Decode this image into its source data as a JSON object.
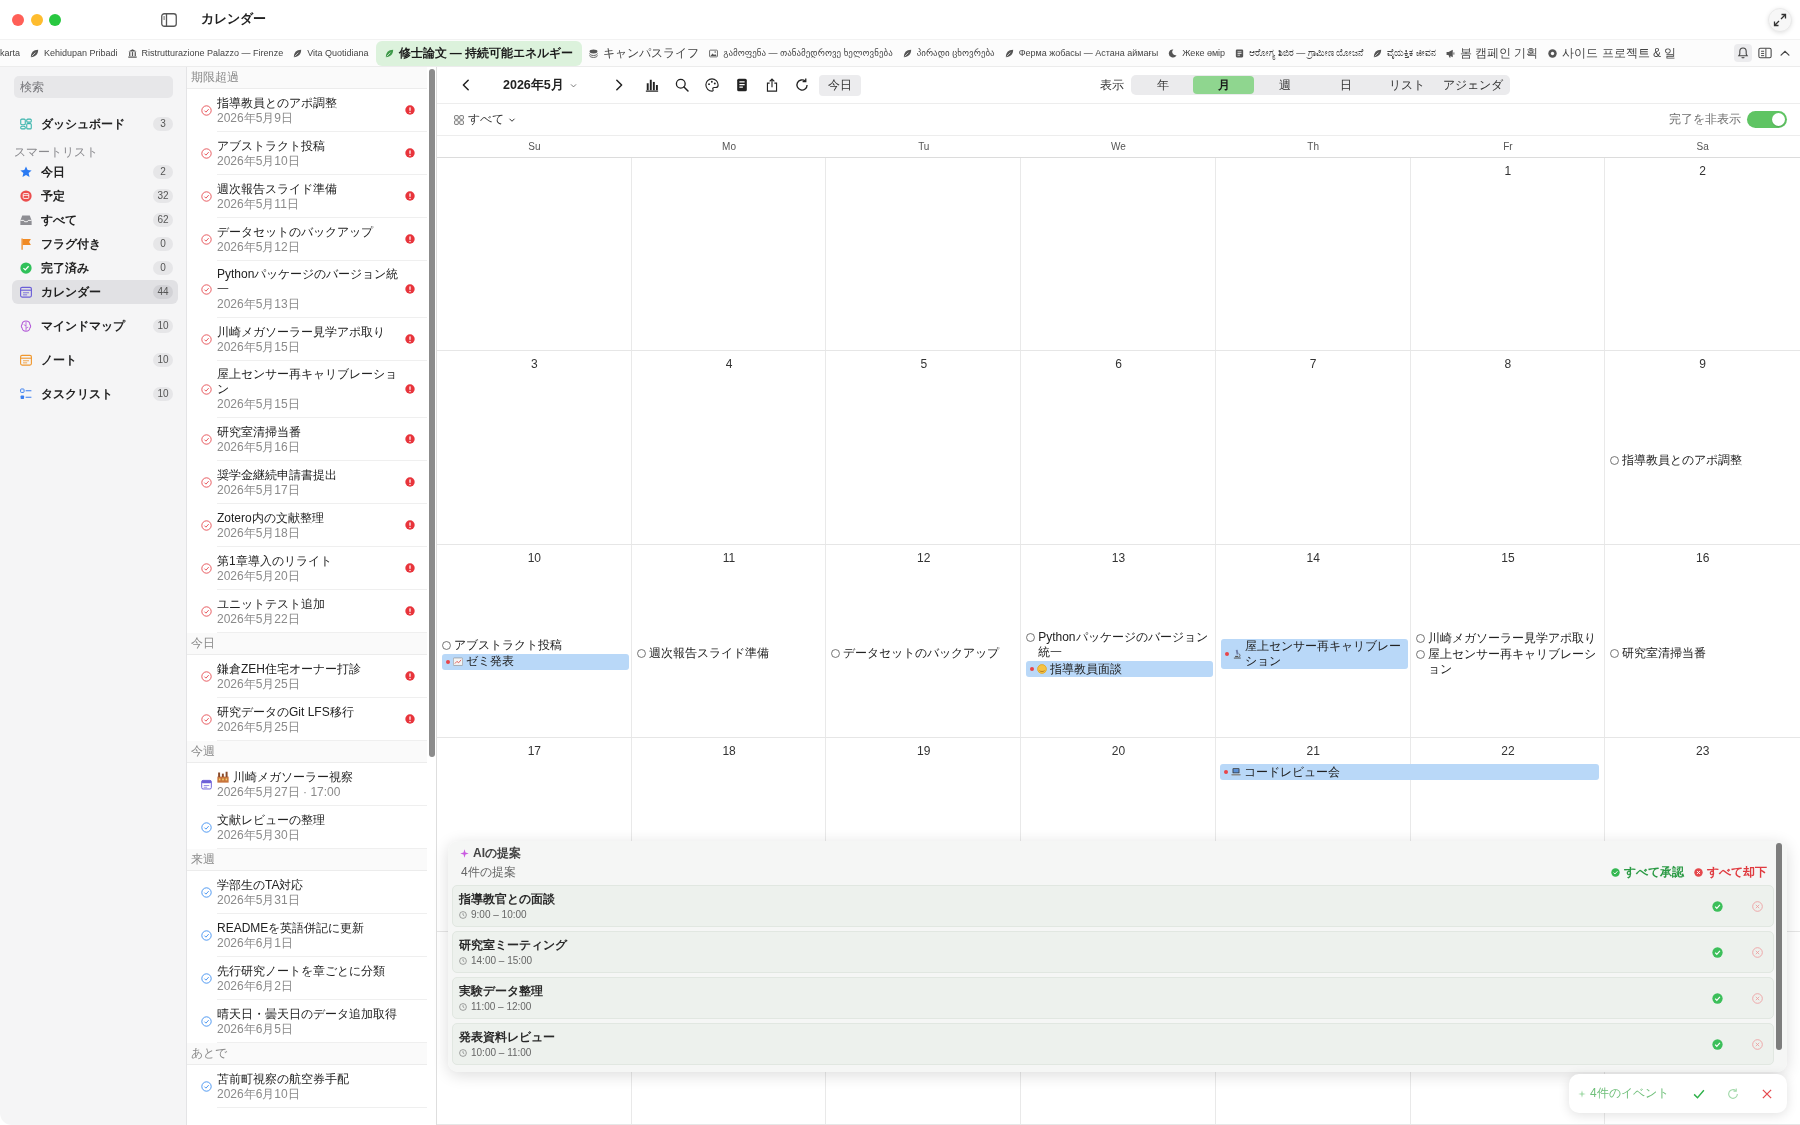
{
  "window": {
    "title": "カレンダー"
  },
  "tabs": [
    {
      "label": "karta",
      "selected": false
    },
    {
      "label": "Kehidupan Pribadi",
      "selected": false
    },
    {
      "label": "Ristrutturazione Palazzo — Firenze",
      "selected": false
    },
    {
      "label": "Vita Quotidiana",
      "selected": false
    },
    {
      "label": "修士論文 — 持続可能エネルギー",
      "selected": true
    },
    {
      "label": "キャンパスライフ",
      "selected": false
    },
    {
      "label": "გამოფენა — თანამედროვე ხელოვნება",
      "selected": false
    },
    {
      "label": "პირადი ცხოვრება",
      "selected": false
    },
    {
      "label": "Ферма жобасы — Астана аймағы",
      "selected": false
    },
    {
      "label": "Жеке өмір",
      "selected": false
    },
    {
      "label": "ಆರೋಗ್ಯ ಶಿಬಿರ — ಗ್ರಾಮೀಣ ಯೋಜನೆ",
      "selected": false
    },
    {
      "label": "ವೈಯಕ್ತಿಕ ಜೀವನ",
      "selected": false
    },
    {
      "label": "봄 캠페인 기획",
      "selected": false
    },
    {
      "label": "사이드 프로젝트 & 일",
      "selected": false
    }
  ],
  "sidebar": {
    "search": {
      "placeholder": "検索"
    },
    "groups": [
      {
        "items": [
          {
            "label": "ダッシュボード",
            "count": "3",
            "selected": false
          }
        ]
      },
      {
        "heading": "スマートリスト",
        "items": [
          {
            "label": "今日",
            "count": "2",
            "selected": false
          },
          {
            "label": "予定",
            "count": "32",
            "selected": false
          },
          {
            "label": "すべて",
            "count": "62",
            "selected": false
          },
          {
            "label": "フラグ付き",
            "count": "0",
            "selected": false
          },
          {
            "label": "完了済み",
            "count": "0",
            "selected": false
          },
          {
            "label": "カレンダー",
            "count": "44",
            "selected": true
          }
        ]
      },
      {
        "items": [
          {
            "label": "マインドマップ",
            "count": "10",
            "selected": false
          }
        ]
      },
      {
        "items": [
          {
            "label": "ノート",
            "count": "10",
            "selected": false
          }
        ]
      },
      {
        "items": [
          {
            "label": "タスクリスト",
            "count": "10",
            "selected": false
          }
        ]
      }
    ]
  },
  "task_list": {
    "sections": [
      {
        "heading": "期限超過",
        "items": [
          {
            "kind": "task",
            "title": "指導教員とのアポ調整",
            "date": "2026年5月9日",
            "overdue": true,
            "high_priority": true
          },
          {
            "kind": "task",
            "title": "アブストラクト投稿",
            "date": "2026年5月10日",
            "overdue": true,
            "high_priority": true
          },
          {
            "kind": "task",
            "title": "週次報告スライド準備",
            "date": "2026年5月11日",
            "overdue": true,
            "high_priority": true
          },
          {
            "kind": "task",
            "title": "データセットのバックアップ",
            "date": "2026年5月12日",
            "overdue": true,
            "high_priority": true
          },
          {
            "kind": "task",
            "title": "Pythonパッケージのバージョン統一",
            "date": "2026年5月13日",
            "overdue": true,
            "high_priority": true
          },
          {
            "kind": "task",
            "title": "川崎メガソーラー見学アポ取り",
            "date": "2026年5月15日",
            "overdue": true,
            "high_priority": true
          },
          {
            "kind": "task",
            "title": "屋上センサー再キャリブレーション",
            "date": "2026年5月15日",
            "overdue": true,
            "high_priority": true
          },
          {
            "kind": "task",
            "title": "研究室清掃当番",
            "date": "2026年5月16日",
            "overdue": true,
            "high_priority": true
          },
          {
            "kind": "task",
            "title": "奨学金継続申請書提出",
            "date": "2026年5月17日",
            "overdue": true,
            "high_priority": true
          },
          {
            "kind": "task",
            "title": "Zotero内の文献整理",
            "date": "2026年5月18日",
            "overdue": true,
            "high_priority": true
          },
          {
            "kind": "task",
            "title": "第1章導入のリライト",
            "date": "2026年5月20日",
            "overdue": true,
            "high_priority": true
          },
          {
            "kind": "task",
            "title": "ユニットテスト追加",
            "date": "2026年5月22日",
            "overdue": true,
            "high_priority": true
          }
        ]
      },
      {
        "heading": "今日",
        "items": [
          {
            "kind": "task",
            "title": "鎌倉ZEH住宅オーナー打診",
            "date": "2026年5月25日",
            "overdue": true,
            "high_priority": true
          },
          {
            "kind": "task",
            "title": "研究データのGit LFS移行",
            "date": "2026年5月25日",
            "overdue": true,
            "high_priority": true
          }
        ]
      },
      {
        "heading": "今週",
        "items": [
          {
            "kind": "event",
            "title": "川崎メガソーラー視察",
            "date": "2026年5月27日 · 17:00",
            "overdue": false,
            "high_priority": false
          },
          {
            "kind": "task",
            "title": "文献レビューの整理",
            "date": "2026年5月30日",
            "overdue": false,
            "high_priority": false
          }
        ]
      },
      {
        "heading": "来週",
        "items": [
          {
            "kind": "task",
            "title": "学部生のTA対応",
            "date": "2026年5月31日",
            "overdue": false,
            "high_priority": false
          },
          {
            "kind": "task",
            "title": "READMEを英語併記に更新",
            "date": "2026年6月1日",
            "overdue": false,
            "high_priority": false
          },
          {
            "kind": "task",
            "title": "先行研究ノートを章ごとに分類",
            "date": "2026年6月2日",
            "overdue": false,
            "high_priority": false
          },
          {
            "kind": "task",
            "title": "晴天日・曇天日のデータ追加取得",
            "date": "2026年6月5日",
            "overdue": false,
            "high_priority": false
          }
        ]
      },
      {
        "heading": "あとで",
        "items": [
          {
            "kind": "task",
            "title": "苫前町視察の航空券手配",
            "date": "2026年6月10日",
            "overdue": false,
            "high_priority": false
          }
        ]
      }
    ]
  },
  "calendar": {
    "toolbar": {
      "month": "2026年5月",
      "today_button": "今日",
      "view_label": "表示",
      "views": [
        {
          "label": "年",
          "selected": false
        },
        {
          "label": "月",
          "selected": true
        },
        {
          "label": "週",
          "selected": false
        },
        {
          "label": "日",
          "selected": false
        },
        {
          "label": "リスト",
          "selected": false
        },
        {
          "label": "アジェンダ",
          "selected": false
        }
      ]
    },
    "filter": {
      "label": "すべて"
    },
    "hide_completed": {
      "label": "完了を非表示",
      "on": true
    },
    "weekdays": [
      "Su",
      "Mo",
      "Tu",
      "We",
      "Th",
      "Fr",
      "Sa"
    ],
    "weeks": [
      {
        "days": [
          {
            "date": "1"
          },
          {
            "date": "2"
          }
        ]
      },
      {
        "days": [
          {
            "date": "3"
          },
          {
            "date": "4"
          },
          {
            "date": "5"
          },
          {
            "date": "6"
          },
          {
            "date": "7"
          },
          {
            "date": "8"
          },
          {
            "date": "9",
            "items": [
              {
                "kind": "task",
                "title": "指導教員とのアポ調整",
                "done": false
              }
            ]
          }
        ]
      },
      {
        "days": [
          {
            "date": "10",
            "items": [
              {
                "kind": "task",
                "title": "アブストラクト投稿",
                "done": false
              },
              {
                "kind": "event",
                "title": "ゼミ発表",
                "continues_next_day": false
              }
            ]
          },
          {
            "date": "11",
            "items": [
              {
                "kind": "task",
                "title": "週次報告スライド準備",
                "done": false
              }
            ]
          },
          {
            "date": "12",
            "items": [
              {
                "kind": "task",
                "title": "データセットのバックアップ",
                "done": false
              }
            ]
          },
          {
            "date": "13",
            "items": [
              {
                "kind": "task",
                "title": "Pythonパッケージのバージョン統一",
                "done": false
              },
              {
                "kind": "event",
                "title": "指導教員面談",
                "continues_next_day": false
              }
            ]
          },
          {
            "date": "14",
            "items": [
              {
                "kind": "event",
                "title": "屋上センサー再キャリブレーション",
                "continues_next_day": false
              }
            ]
          },
          {
            "date": "15",
            "items": [
              {
                "kind": "task",
                "title": "川崎メガソーラー見学アポ取り",
                "done": false
              },
              {
                "kind": "task",
                "title": "屋上センサー再キャリブレーション",
                "done": false
              }
            ]
          },
          {
            "date": "16",
            "items": [
              {
                "kind": "task",
                "title": "研究室清掃当番",
                "done": false
              }
            ]
          }
        ]
      },
      {
        "days": [
          {
            "date": "17"
          },
          {
            "date": "18"
          },
          {
            "date": "19"
          },
          {
            "date": "20"
          },
          {
            "date": "21",
            "items": [
              {
                "kind": "event",
                "title": "コードレビュー会",
                "continues_next_day": true
              }
            ]
          },
          {
            "date": "22"
          },
          {
            "date": "23"
          }
        ]
      }
    ]
  },
  "ai_suggestions": {
    "title": "AIの提案",
    "count": "4件の提案",
    "accept_all": "すべて承認",
    "reject_all": "すべて却下",
    "items": [
      {
        "title": "指導教官との面談",
        "time": "9:00 – 10:00"
      },
      {
        "title": "研究室ミーティング",
        "time": "14:00 – 15:00"
      },
      {
        "title": "実験データ整理",
        "time": "11:00 – 12:00"
      },
      {
        "title": "発表資料レビュー",
        "time": "10:00 – 11:00"
      }
    ]
  },
  "ai_bar": {
    "label": "4件のイベント"
  }
}
